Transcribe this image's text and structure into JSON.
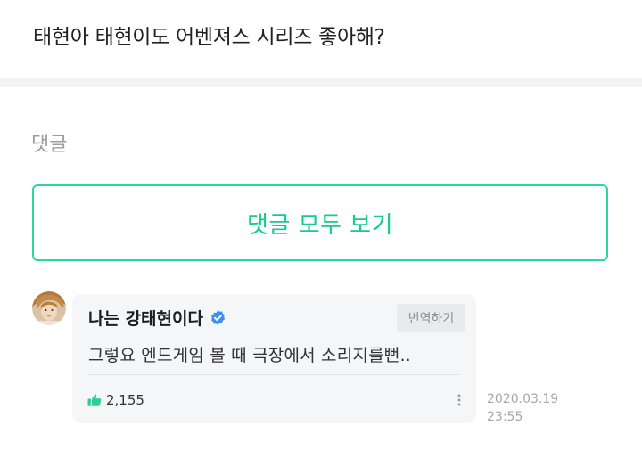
{
  "question": {
    "text": "태현아 태현이도 어벤져스 시리즈 좋아해?"
  },
  "comments_section": {
    "label": "댓글",
    "view_all_label": "댓글 모두 보기"
  },
  "comment": {
    "author": "나는 강태현이다",
    "verified": true,
    "translate_label": "번역하기",
    "text": "그렇요 엔드게임 볼 때 극장에서 소리지를뻔..",
    "likes": "2,155",
    "date": "2020.03.19",
    "time": "23:55"
  },
  "colors": {
    "accent": "#19c98f",
    "accent_border": "#2ed7a0",
    "verified_badge": "#3a8ff1",
    "bubble_bg": "#f5f6f7"
  },
  "icons": {
    "verified": "verified-badge-icon",
    "like": "thumbs-up-icon",
    "more": "more-vertical-icon"
  }
}
